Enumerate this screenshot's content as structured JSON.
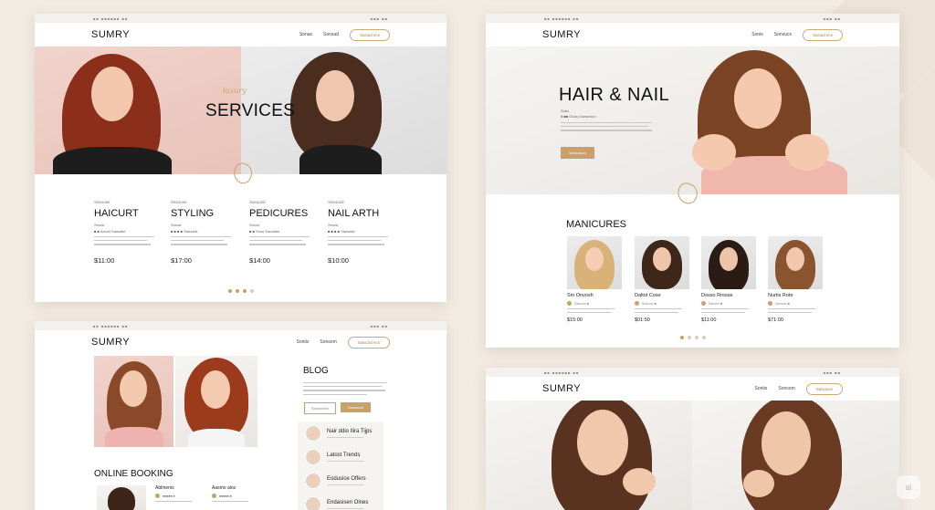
{
  "mock1": {
    "strip_left": "■■ ■■■■■■ ■■",
    "strip_right": "■■■ ■■",
    "logo": "SUMRY",
    "nav": [
      "Sonas",
      "Sonsad"
    ],
    "nav_button": "Sasiod ecs",
    "script_text": "luxury",
    "hero_title": "SERVICES",
    "services": [
      {
        "eyebrow": "Sasouse",
        "title": "HAICURT",
        "sub1": "Smost",
        "sub2": "■ ■ Arsvel  Sansalst",
        "price": "$11:00"
      },
      {
        "eyebrow": "Sasouse",
        "title": "STYLING",
        "sub1": "Smost",
        "sub2": "■ ■ ■ ■  Sansalst",
        "price": "$17:00"
      },
      {
        "eyebrow": "Sasousd",
        "title": "PEDICURES",
        "sub1": "Smost",
        "sub2": "■ ■ Srow  Sandalst",
        "price": "$14:00"
      },
      {
        "eyebrow": "Sasousd",
        "title": "NAIL ARTH",
        "sub1": "Smost",
        "sub2": "■ ■ ■ ■  Sansalst",
        "price": "$10:00"
      }
    ]
  },
  "mock2": {
    "strip_left": "■■ ■■■■■■ ■■",
    "strip_right": "■■■ ■■",
    "logo": "SUMRY",
    "nav": [
      "Sonis",
      "Sonsucs"
    ],
    "nav_button": "Sasiod ecs",
    "hero_title": "HAIR & NAIL",
    "hero_eyebrow": "Sotio",
    "hero_sub": "$ ■■ Oodo  Sorwcsion",
    "hero_button": "Sorwusicis",
    "section_title": "MANICURES",
    "cards": [
      {
        "name": "Sm Onvosh",
        "meta": "Sansolo ■",
        "price": "$15:00"
      },
      {
        "name": "Daltot Cose",
        "meta": "Sonsolo ■",
        "price": "$01:50"
      },
      {
        "name": "Dosso Rrosse",
        "meta": "Sanoler ■",
        "price": "$11:00"
      },
      {
        "name": "Nurtis Rote",
        "meta": "Sansolo ■",
        "price": "$71:00"
      }
    ]
  },
  "mock3": {
    "strip_left": "■■ ■■■■■■ ■■",
    "strip_right": "■■■ ■■",
    "logo": "SUMRY",
    "nav": [
      "Sonits",
      "Sonsom"
    ],
    "nav_button": "Sasicod ecs",
    "blog_title": "BLOG",
    "blog_btn1": "Sonsomss",
    "blog_btn2": "Soosurou",
    "booking_title": "ONLINE BOOKING",
    "booking_cols": [
      "Ablmenis",
      "Aasmo alos"
    ],
    "sidebar": [
      "Nair ddio Ilira Tijps",
      "Latost Trends",
      "Eodusice Offers",
      "Endasisen Olnes"
    ]
  },
  "mock4": {
    "strip_left": "■■ ■■■■■■ ■■",
    "strip_right": "■■■ ■■",
    "logo": "SUMRY",
    "nav": [
      "Sonits",
      "Sonsom"
    ],
    "nav_button": "Sasiovos"
  },
  "watermark": "ai",
  "colors": {
    "accent": "#c9a06a",
    "background": "#f3ece4"
  }
}
